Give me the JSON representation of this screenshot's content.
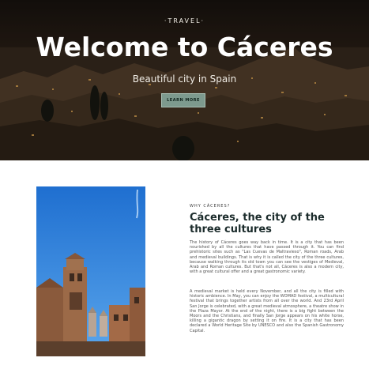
{
  "hero": {
    "eyebrow": "·TRAVEL·",
    "title": "Welcome to Cáceres",
    "subtitle": "Beautiful city in Spain",
    "button_label": "LEARN MORE"
  },
  "about": {
    "kicker": "WHY CÁCERES?",
    "title": "Cáceres, the city of the three cultures",
    "paragraphs": [
      "The history of Cáceres goes way back in time. It is a city that has been nourished by all the cultures that have passed through it. You can find prehistoric sites such as \"Las Cuevas de Maltravieso\", Roman roads, Arab and medieval buildings. That is why it is called the city of the three cultures, because walking through its old town you can see the vestiges of Medieval, Arab and Roman cultures. But that's not all, Cáceres is also a modern city, with a great cultural offer and a great gastronomic variety.",
      "A medieval market is held every November, and all the city is filled with historic ambience. In May, you can enjoy the WOMAD festival, a multicultural festival that brings together artists from all over the world. And 23rd April San Jorge is celebrated, with a great medieval atmosphere, a theatre show in the Plaza Mayor. At the end of the night, there is a big fight between the Moors and the Christians, and finally San Jorge appears on his white horse, killing a gigantic dragon by setting it on fire. It is a city that has been declared a World Heritage Site by UNESCO and also the Spanish Gastronomy Capital."
    ]
  },
  "colors": {
    "button_bg": "#7d9a8e",
    "title_text": "#1b2b2b",
    "body_text": "#555555",
    "sky_blue": "#2f86d9"
  }
}
